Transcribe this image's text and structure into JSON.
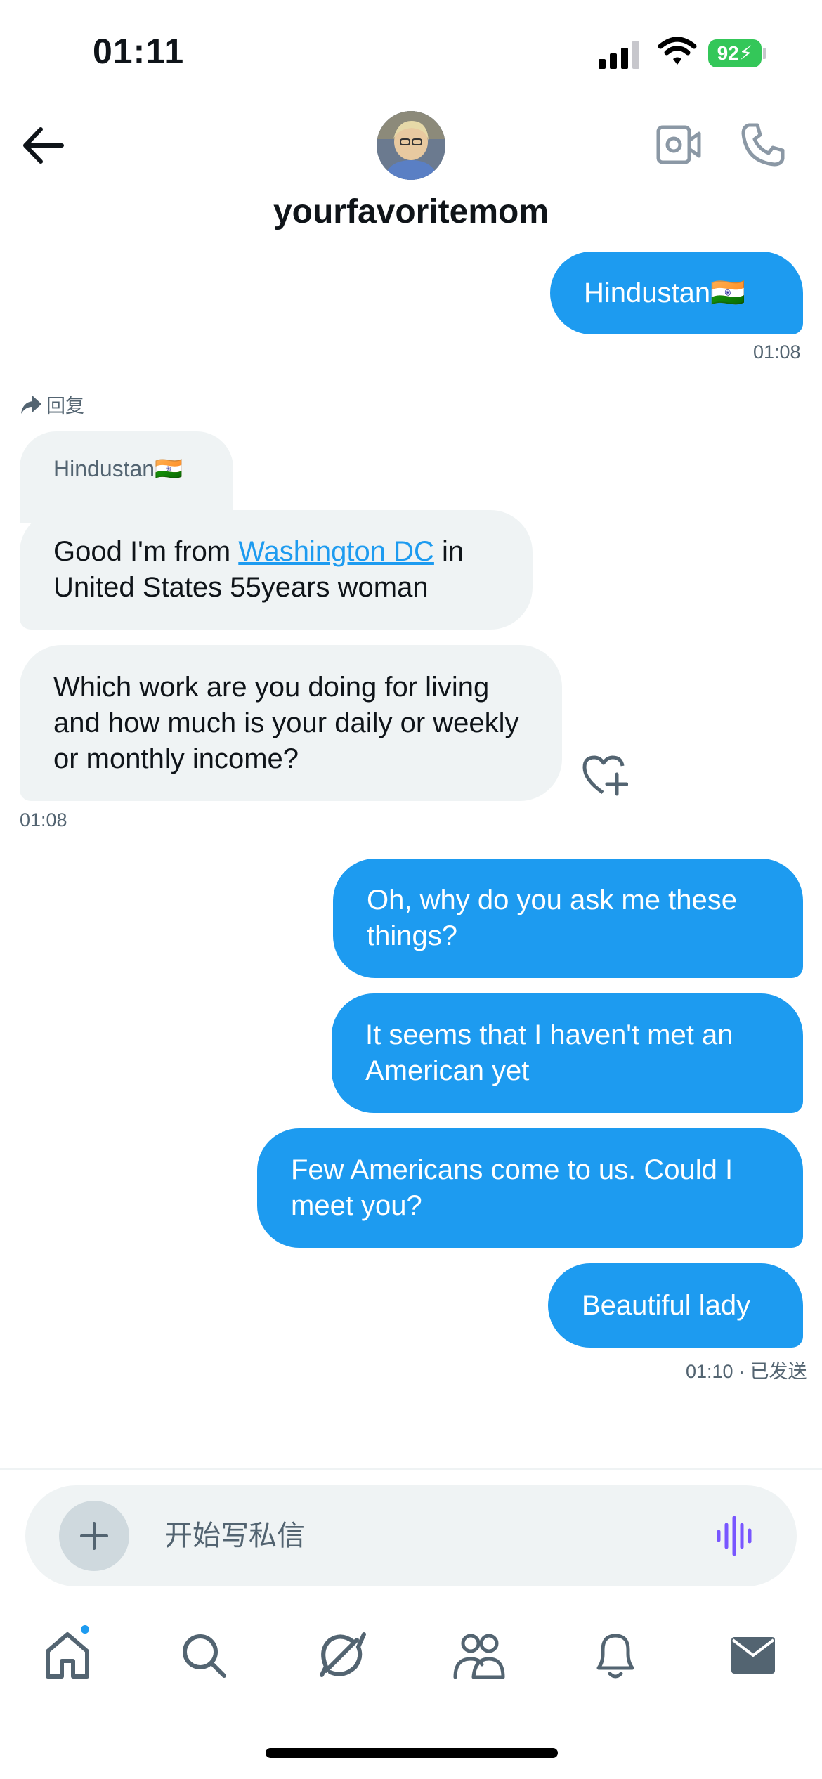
{
  "status_bar": {
    "time": "01:11",
    "battery": "92"
  },
  "header": {
    "contact_name": "yourfavoritemom"
  },
  "messages": {
    "m1": {
      "text": "Hindustan🇮🇳",
      "time": "01:08"
    },
    "reply": {
      "label": "回复",
      "quoted": "Hindustan🇮🇳"
    },
    "m2": {
      "pre": "Good I'm from ",
      "link": "Washington DC",
      "post": " in United States 55years woman"
    },
    "m3": {
      "text": "Which work are you doing for living and how much is your daily or weekly or monthly income?",
      "time": "01:08"
    },
    "m4": {
      "text": "Oh, why do you ask me these things?"
    },
    "m5": {
      "text": "It seems that I haven't met an American yet"
    },
    "m6": {
      "text": "Few Americans come to us. Could I meet you?"
    },
    "m7": {
      "text": "Beautiful lady",
      "status": "01:10 · 已发送"
    }
  },
  "composer": {
    "placeholder": "开始写私信"
  },
  "tabs": [
    "home-icon",
    "search-icon",
    "grok-icon",
    "communities-icon",
    "notifications-icon",
    "messages-icon"
  ],
  "colors": {
    "accent": "#1d9bf0",
    "incoming_bg": "#eff3f4",
    "voice": "#7856ff"
  }
}
